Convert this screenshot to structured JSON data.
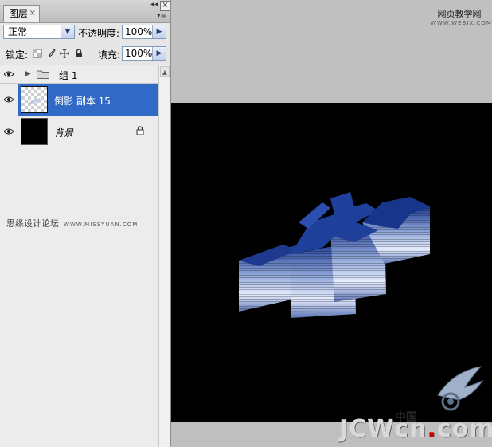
{
  "panel": {
    "tab_label": "图层",
    "tab_close": "×",
    "window_minimize": "◂◂",
    "window_close": "×",
    "panel_menu": "▾≡",
    "blend_mode": "正常",
    "opacity_label": "不透明度:",
    "opacity_value": "100%",
    "lock_label": "锁定:",
    "fill_label": "填充:",
    "fill_value": "100%",
    "layers": [
      {
        "name": "组 1",
        "type": "group",
        "visible": true,
        "selected": false
      },
      {
        "name": "倒影 副本 15",
        "type": "layer",
        "visible": true,
        "selected": true
      },
      {
        "name": "背景",
        "type": "background",
        "visible": true,
        "selected": false,
        "locked": true
      }
    ]
  },
  "watermark_left": {
    "text": "思缘设计论坛",
    "url": "WWW.MISSYUAN.COM"
  },
  "watermark_top_right": {
    "text": "网页教学网",
    "url": "WWW.WEBJX.COM"
  },
  "watermark_bottom": {
    "brand_pre": "JCW",
    "brand_mid": "cn",
    "brand_dot": ".",
    "brand_post": "com",
    "cn_text": "中国"
  },
  "colors": {
    "selection": "#3169c6",
    "canvas_bg": "#000000",
    "art_blue": "#1e3f9a",
    "art_highlight": "#dfe8ff"
  },
  "icons": {
    "eye": "eye-icon",
    "folder": "folder-icon",
    "lock": "lock-icon",
    "lock_transparent": "lock-transparent-icon",
    "lock_paint": "brush-icon",
    "lock_move": "move-icon"
  }
}
